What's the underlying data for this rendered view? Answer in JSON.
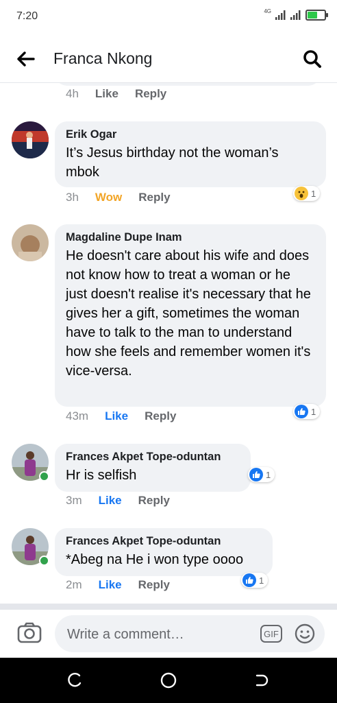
{
  "status_bar": {
    "time": "7:20",
    "network": "4G"
  },
  "header": {
    "title": "Franca Nkong"
  },
  "previous_comment": {
    "time": "4h",
    "like_label": "Like",
    "reply_label": "Reply"
  },
  "comments": [
    {
      "author": "Erik Ogar",
      "text": "It’s Jesus birthday not the woman’s mbok",
      "time": "3h",
      "reaction_label": "Wow",
      "reply_label": "Reply",
      "reaction_icon": "wow-icon",
      "reaction_count": "1",
      "online": false
    },
    {
      "author": "Magdaline Dupe Inam",
      "text": "He doesn't care about his wife and does not know how to treat a woman or he just doesn't realise it's necessary that he gives her a gift, sometimes the woman have to talk to the man to understand how she feels and remember women it's vice-versa.",
      "time": "43m",
      "reaction_label": "Like",
      "reply_label": "Reply",
      "reaction_icon": "like-icon",
      "reaction_count": "1",
      "online": false
    },
    {
      "author": "Frances Akpet Tope-oduntan",
      "text": "Hr is selfish",
      "time": "3m",
      "reaction_label": "Like",
      "reply_label": "Reply",
      "reaction_icon": "like-icon",
      "reaction_count": "1",
      "online": true
    },
    {
      "author": "Frances Akpet Tope-oduntan",
      "text": "*Abeg na He i won type oooo",
      "time": "2m",
      "reaction_label": "Like",
      "reply_label": "Reply",
      "reaction_icon": "like-icon",
      "reaction_count": "1",
      "online": true
    }
  ],
  "composer": {
    "placeholder": "Write a comment…",
    "gif_label": "GIF"
  },
  "colors": {
    "like_blue": "#1877f2",
    "wow_yellow": "#f2a527",
    "bubble_bg": "#f0f2f5",
    "online_green": "#31a24c"
  }
}
